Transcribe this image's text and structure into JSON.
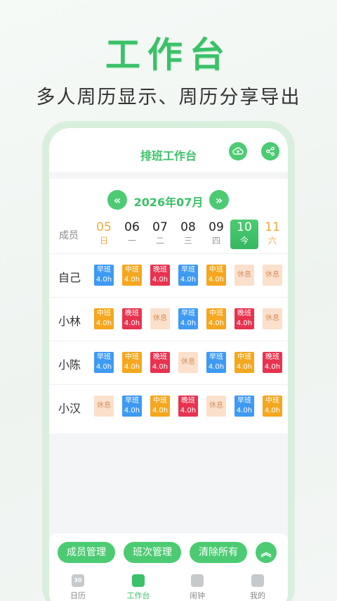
{
  "hero": {
    "title": "工作台",
    "subtitle": "多人周历显示、周历分享导出"
  },
  "app": {
    "title": "排班工作台",
    "upload_icon": "cloud-upload-icon",
    "share_icon": "share-icon",
    "month": "2026年07月",
    "prev_icon": "double-chevron-left-icon",
    "next_icon": "double-chevron-right-icon",
    "member_header": "成员",
    "days": [
      {
        "num": "05",
        "wd": "日"
      },
      {
        "num": "06",
        "wd": "一"
      },
      {
        "num": "07",
        "wd": "二"
      },
      {
        "num": "08",
        "wd": "三"
      },
      {
        "num": "09",
        "wd": "四"
      },
      {
        "num": "10",
        "wd": "今"
      },
      {
        "num": "11",
        "wd": "六"
      }
    ],
    "members": [
      {
        "name": "自己",
        "shifts": [
          {
            "t": "早班",
            "h": "4.0h"
          },
          {
            "t": "中班",
            "h": "4.0h"
          },
          {
            "t": "晚班",
            "h": "4.0h"
          },
          {
            "t": "早班",
            "h": "4.0h"
          },
          {
            "t": "中班",
            "h": "4.0h"
          },
          {
            "t": "休息",
            "h": ""
          },
          {
            "t": "休息",
            "h": ""
          }
        ]
      },
      {
        "name": "小林",
        "shifts": [
          {
            "t": "中班",
            "h": "4.0h"
          },
          {
            "t": "晚班",
            "h": "4.0h"
          },
          {
            "t": "休息",
            "h": ""
          },
          {
            "t": "早班",
            "h": "4.0h"
          },
          {
            "t": "中班",
            "h": "4.0h"
          },
          {
            "t": "晚班",
            "h": "4.0h"
          },
          {
            "t": "休息",
            "h": ""
          }
        ]
      },
      {
        "name": "小陈",
        "shifts": [
          {
            "t": "早班",
            "h": "4.0h"
          },
          {
            "t": "中班",
            "h": "4.0h"
          },
          {
            "t": "晚班",
            "h": "4.0h"
          },
          {
            "t": "休息",
            "h": ""
          },
          {
            "t": "早班",
            "h": "4.0h"
          },
          {
            "t": "中班",
            "h": "4.0h"
          },
          {
            "t": "晚班",
            "h": "4.0h"
          }
        ]
      },
      {
        "name": "小汉",
        "shifts": [
          {
            "t": "休息",
            "h": ""
          },
          {
            "t": "早班",
            "h": "4.0h"
          },
          {
            "t": "中班",
            "h": "4.0h"
          },
          {
            "t": "晚班",
            "h": "4.0h"
          },
          {
            "t": "休息",
            "h": ""
          },
          {
            "t": "早班",
            "h": "4.0h"
          },
          {
            "t": "中班",
            "h": "4.0h"
          }
        ]
      }
    ],
    "actions": {
      "members": "成员管理",
      "shifts": "班次管理",
      "clear": "清除所有",
      "collapse_icon": "double-chevron-up-icon"
    },
    "tabs": [
      {
        "label": "日历",
        "icon": "calendar-icon",
        "glyph": "30"
      },
      {
        "label": "工作台",
        "icon": "workbench-icon",
        "glyph": ""
      },
      {
        "label": "闹钟",
        "icon": "alarm-icon",
        "glyph": ""
      },
      {
        "label": "我的",
        "icon": "profile-icon",
        "glyph": ""
      }
    ],
    "colors": {
      "accent": "#3cc168",
      "early": "#3e9af2",
      "mid": "#f5a71f",
      "late": "#e8334f",
      "rest": "#fbe0cc"
    }
  }
}
